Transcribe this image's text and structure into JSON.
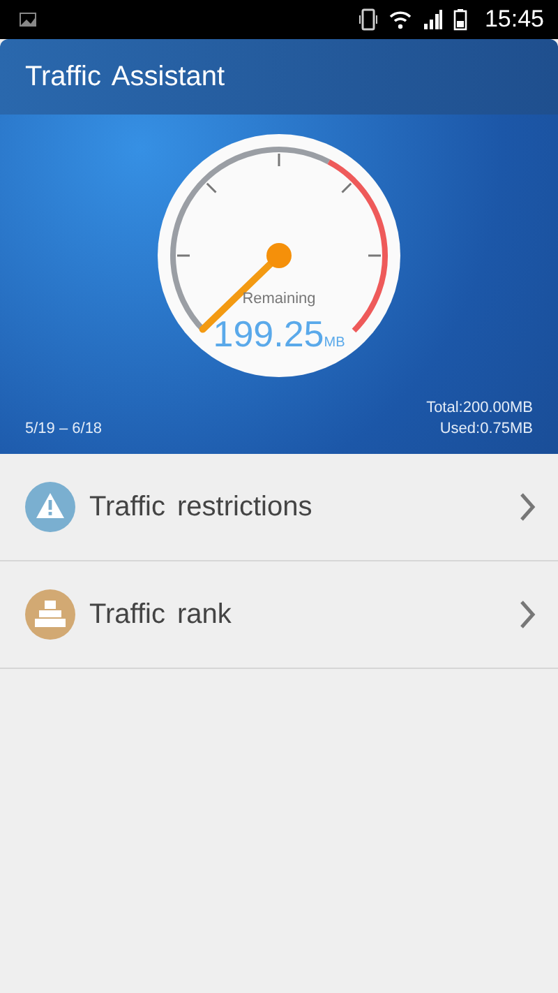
{
  "status_bar": {
    "time": "15:45"
  },
  "header": {
    "title": "Traffic Assistant"
  },
  "gauge": {
    "caption": "Remaining",
    "value": "199.25",
    "unit": "MB"
  },
  "period": "5/19 – 6/18",
  "totals": [
    "Total:200.00MB",
    "Used:0.75MB"
  ],
  "items": [
    {
      "kind": "warning",
      "label": "Traffic restrictions",
      "color": "#7aafd0"
    },
    {
      "kind": "rank",
      "label": "Traffic rank",
      "color": "#d2a973"
    }
  ]
}
